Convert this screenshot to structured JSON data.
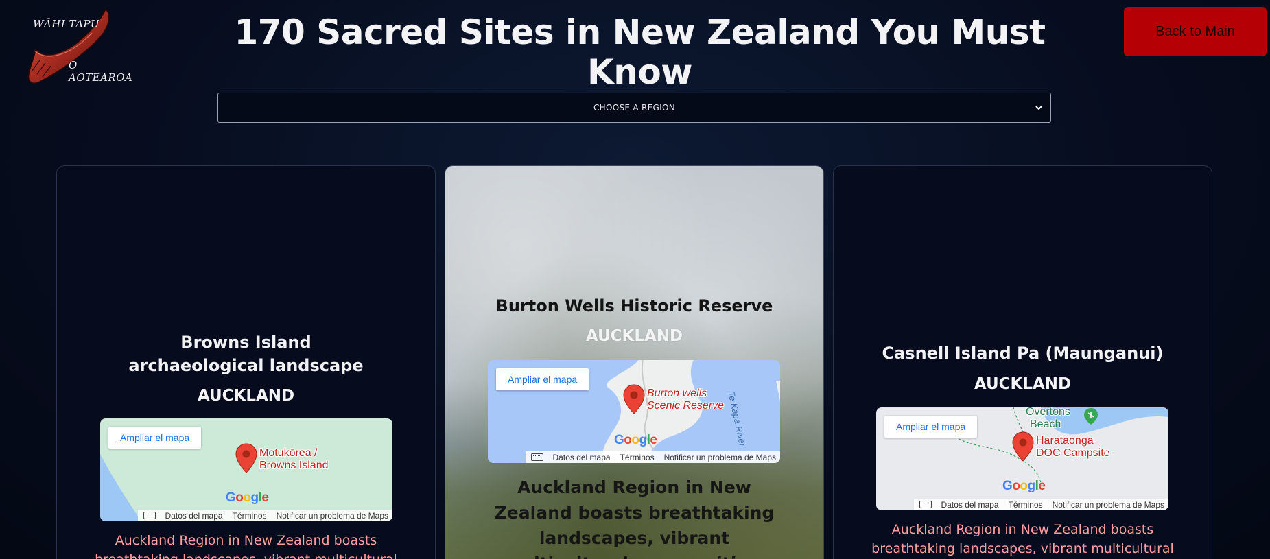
{
  "header": {
    "logo_text_top": "WĀHI TAPU",
    "logo_text_bottom": "O AOTEAROA",
    "page_title": "170 Sacred Sites in New Zealand You Must Know",
    "back_button": "Back to Main"
  },
  "filter": {
    "region_select_label": "CHOOSE A REGION"
  },
  "map_common": {
    "expand_button": "Ampliar el mapa",
    "footer_data": "Datos del mapa",
    "footer_terms": "Términos",
    "footer_report": "Notificar un problema de Maps",
    "google_wordmark": "Google"
  },
  "cards": [
    {
      "title_line1": "Browns Island",
      "title_line2": "archaeological landscape",
      "region": "AUCKLAND",
      "map_pin_label_line1": "Motukōrea /",
      "map_pin_label_line2": "Browns Island",
      "description": "Auckland Region in New Zealand boasts breathtaking landscapes, vibrant multicultural"
    },
    {
      "title_line1": "Burton Wells Historic Reserve",
      "region": "AUCKLAND",
      "map_pin_label_line1": "Burton wells",
      "map_pin_label_line2": "Scenic Reserve",
      "map_river_label": "Te Kapa River",
      "description": "Auckland Region in New Zealand boasts breathtaking landscapes, vibrant multicultural communities,"
    },
    {
      "title_line1": "Casnell Island Pa (Maunganui)",
      "region": "AUCKLAND",
      "map_pin_label_line1": "Harataonga",
      "map_pin_label_line2": "DOC Campsite",
      "map_place_line1": "Overtons",
      "map_place_line2": "Beach",
      "description": "Auckland Region in New Zealand boasts breathtaking landscapes, vibrant multicultural"
    }
  ],
  "colors": {
    "background": "#070d1f",
    "back_button_bg": "#b50005",
    "description_text": "#ff9e9e",
    "map_pin": "#ea4335"
  }
}
